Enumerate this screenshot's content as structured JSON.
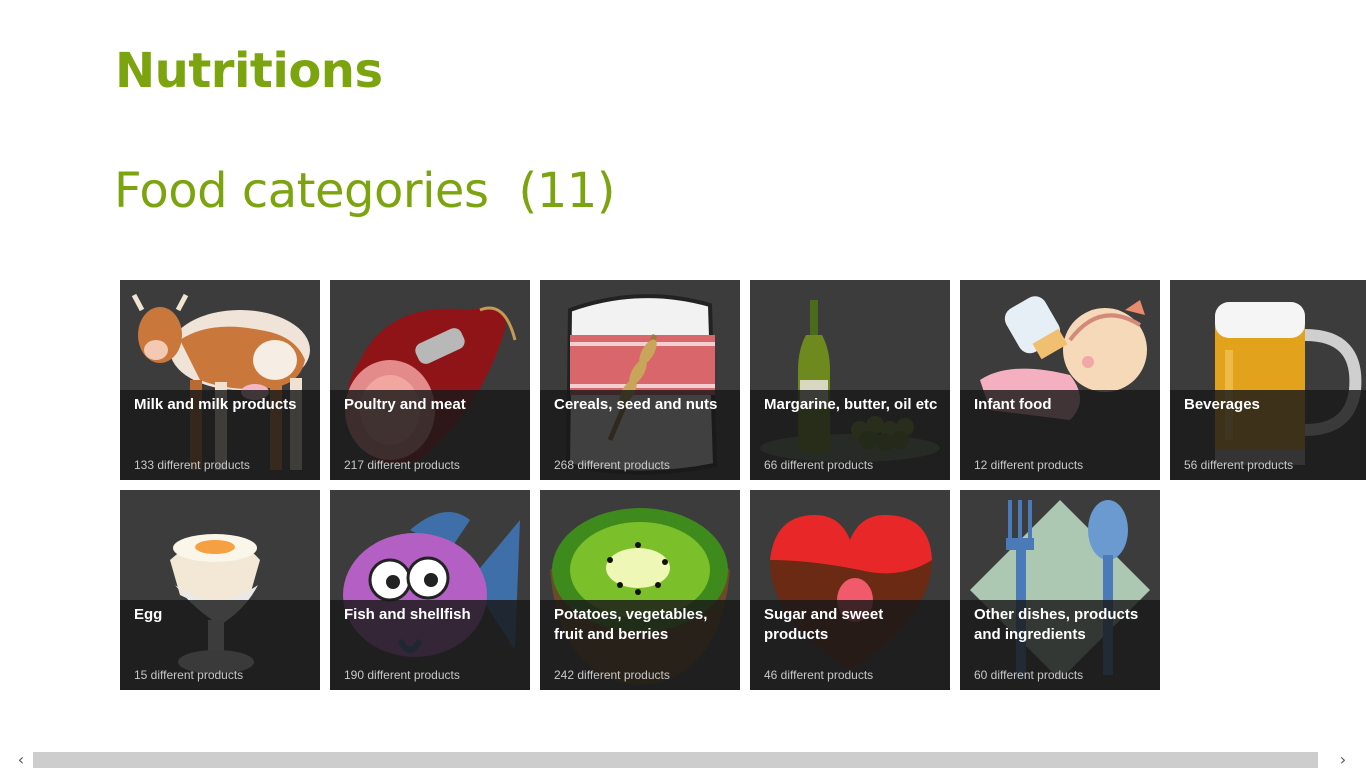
{
  "app": {
    "title": "Nutritions"
  },
  "section": {
    "title": "Food categories",
    "count": "(11)"
  },
  "categories": [
    {
      "name": "Milk and milk products",
      "count": "133 different products",
      "icon": "cow-icon"
    },
    {
      "name": "Poultry and meat",
      "count": "217 different products",
      "icon": "ham-icon"
    },
    {
      "name": "Cereals, seed and nuts",
      "count": "268 different products",
      "icon": "flour-bag-icon"
    },
    {
      "name": "Margarine, butter, oil etc",
      "count": "66 different products",
      "icon": "oil-bottle-icon"
    },
    {
      "name": "Infant food",
      "count": "12 different products",
      "icon": "baby-bottle-icon"
    },
    {
      "name": "Beverages",
      "count": "56 different products",
      "icon": "beer-mug-icon"
    },
    {
      "name": "Egg",
      "count": "15 different products",
      "icon": "boiled-egg-icon"
    },
    {
      "name": "Fish and shellfish",
      "count": "190 different products",
      "icon": "fish-icon"
    },
    {
      "name": "Potatoes, vegetables, fruit and berries",
      "count": "242 different products",
      "icon": "kiwi-icon"
    },
    {
      "name": "Sugar and sweet products",
      "count": "46 different products",
      "icon": "chocolate-heart-icon"
    },
    {
      "name": "Other dishes, products and ingredients",
      "count": "60 different products",
      "icon": "fork-spoon-icon"
    }
  ],
  "scrollbar": {
    "left_arrow": "‹",
    "right_arrow": "›"
  },
  "colors": {
    "accent": "#7ba40f",
    "tile_bg": "#3c3c3c"
  }
}
